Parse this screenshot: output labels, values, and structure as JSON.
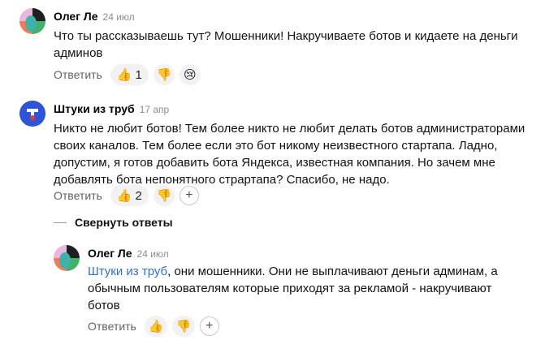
{
  "comments": [
    {
      "author": "Олег Ле",
      "date": "24 июл",
      "text": "Что ты рассказываешь тут? Мошенники! Накручиваете ботов и кидаете на деньги\nадминов",
      "reply": "Ответить",
      "like_count": "1"
    },
    {
      "author": "Штуки из труб",
      "date": "17 апр",
      "text": "Никто не любит ботов! Тем более никто не любит делать ботов администраторами\nсвоих каналов. Тем более если это бот никому неизвестного стартапа. Ладно,\nдопустим, я готов добавить бота Яндекса, известная компания. Но зачем мне\nдобавлять бота непонятного страртапа? Спасибо, не надо.",
      "reply": "Ответить",
      "like_count": "2"
    },
    {
      "author": "Олег Ле",
      "date": "24 июл",
      "mention": "Штуки из труб",
      "text": ", они мошенники. Они не выплачивают деньги админам, а\nобычным пользователям которые приходят за рекламой - накручивают\nботов",
      "reply": "Ответить"
    }
  ],
  "collapse_label": "Свернуть ответы",
  "icons": {
    "like": "thumbs-up-icon",
    "dislike": "thumbs-down-icon",
    "sad": "crying-face-icon",
    "add": "add-reaction-icon"
  }
}
